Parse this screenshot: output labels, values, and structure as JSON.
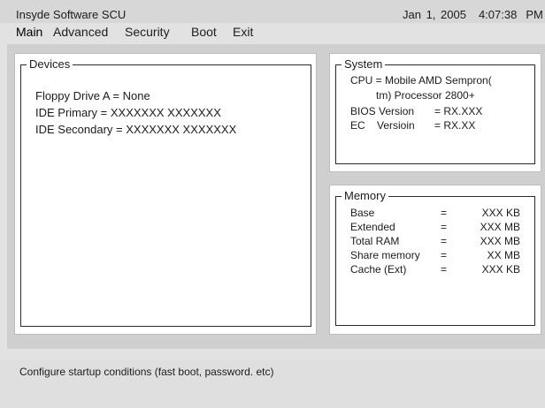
{
  "app": {
    "title": "Insyde Software SCU",
    "date": "Jan 1, 2005",
    "time": "4:07:38",
    "ampm": "PM"
  },
  "menu": {
    "items": [
      "Main",
      "Advanced",
      "Security",
      "Boot",
      "Exit"
    ],
    "active": "Main"
  },
  "devices": {
    "legend": "Devices",
    "lines": [
      "Floppy Drive A = None",
      "IDE Primary = XXXXXXX  XXXXXXX",
      "IDE Secondary = XXXXXXX  XXXXXXX"
    ]
  },
  "system": {
    "legend": "System",
    "cpu_line1": "CPU = Mobile AMD Sempron(",
    "cpu_line2": "tm) Processor 2800+",
    "bios_label": "BIOS Version",
    "bios_value": "= RX.XXX",
    "ec_label": "EC    Versioin",
    "ec_value": "= RX.XX"
  },
  "memory": {
    "legend": "Memory",
    "rows": [
      {
        "label": "Base",
        "eq": "=",
        "value": "XXX KB"
      },
      {
        "label": "Extended",
        "eq": "=",
        "value": "XXX MB"
      },
      {
        "label": "Total RAM",
        "eq": "=",
        "value": "XXX MB"
      },
      {
        "label": "Share memory",
        "eq": "=",
        "value": "XX MB"
      },
      {
        "label": "Cache (Ext)",
        "eq": "=",
        "value": "XXX KB"
      }
    ]
  },
  "help": {
    "text": "Configure startup conditions (fast boot, password. etc)"
  },
  "colors": {
    "background": "#e2e2e2",
    "panel_area": "#cfcfcf",
    "panel": "#ffffff",
    "text": "#1c1c1c"
  }
}
